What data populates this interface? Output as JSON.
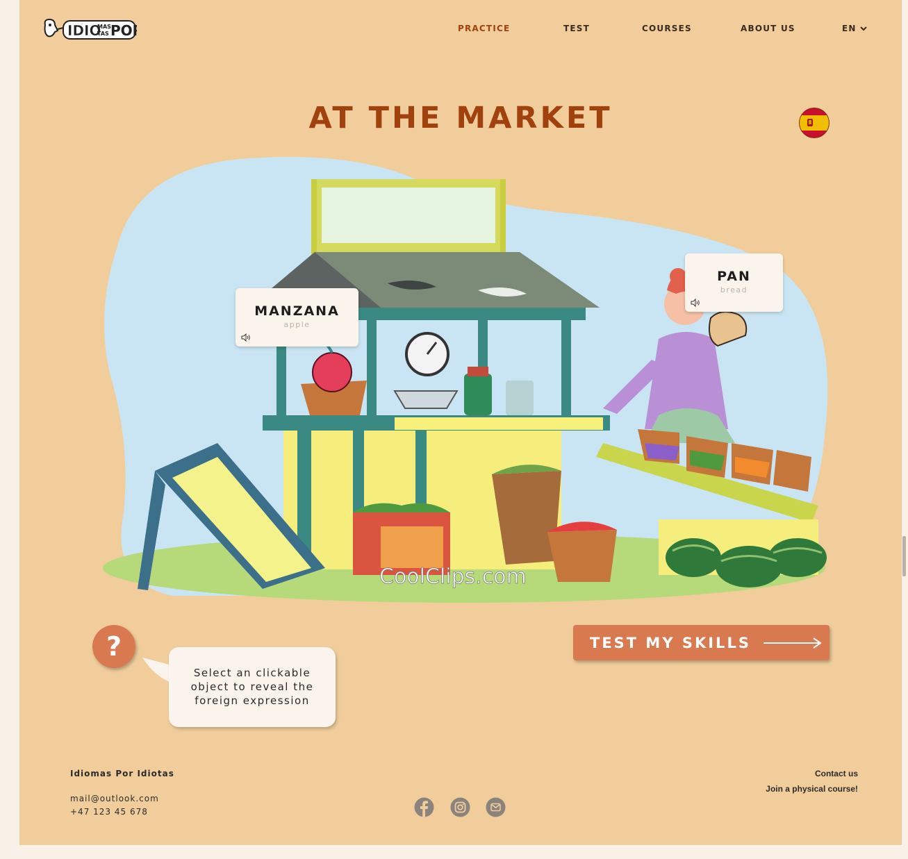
{
  "header": {
    "logo_alt": "Idiomas Por Idiotas",
    "nav": [
      {
        "label": "PRACTICE",
        "active": true
      },
      {
        "label": "TEST",
        "active": false
      },
      {
        "label": "COURSES",
        "active": false
      },
      {
        "label": "ABOUT US",
        "active": false
      }
    ],
    "language": "EN",
    "language_icon": "chevron-down-icon"
  },
  "main": {
    "title": "AT THE MARKET",
    "flag": "spain-flag",
    "watermark": "CoolClips.com",
    "vocab": [
      {
        "word": "MANZANA",
        "translation": "apple",
        "icon": "sound-icon"
      },
      {
        "word": "PAN",
        "translation": "bread",
        "icon": "sound-icon"
      }
    ],
    "help": {
      "symbol": "?",
      "text_lines": [
        "Select an clickable",
        "object to reveal the",
        "foreign expression"
      ]
    },
    "cta_label": "TEST MY SKILLS"
  },
  "footer": {
    "brand": "Idiomas Por Idiotas",
    "email": "mail@outlook.com",
    "phone": "+47 123 45 678",
    "contact_link": "Contact us",
    "join_link": "Join a physical course!",
    "social": [
      "facebook-icon",
      "instagram-icon",
      "mail-icon"
    ]
  },
  "colors": {
    "page_bg": "#f0cd9b",
    "accent": "#a0410e",
    "button": "#d9794f",
    "card": "#fbf4ec"
  }
}
